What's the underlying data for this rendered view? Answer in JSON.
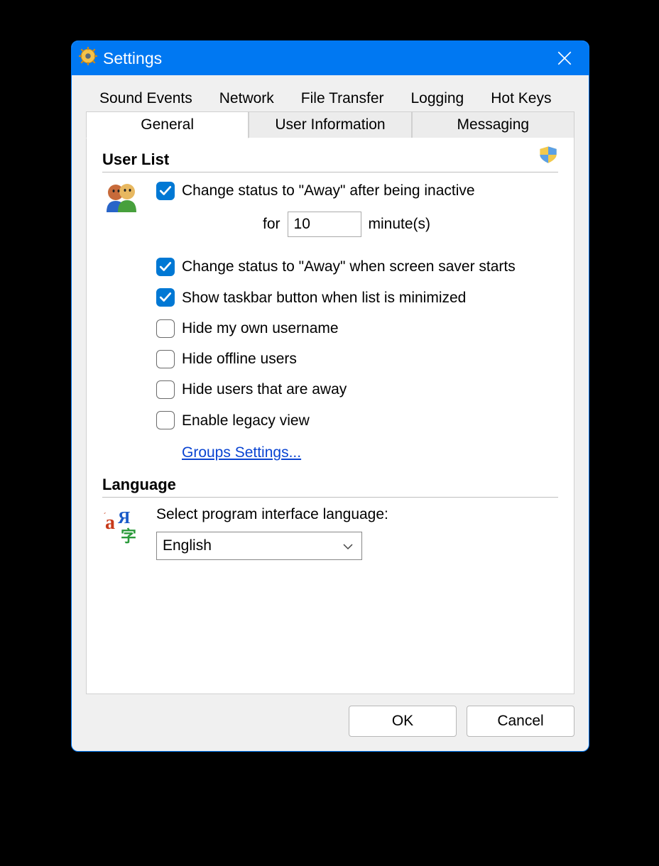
{
  "window": {
    "title": "Settings"
  },
  "tabs": {
    "row1": [
      "Sound Events",
      "Network",
      "File Transfer",
      "Logging",
      "Hot Keys"
    ],
    "row2": [
      "General",
      "User Information",
      "Messaging"
    ],
    "active": "General"
  },
  "user_list": {
    "heading": "User List",
    "options": {
      "away_inactive": {
        "checked": true,
        "label": "Change status to \"Away\" after being inactive"
      },
      "for_label": "for",
      "minutes_value": "10",
      "minutes_unit": "minute(s)",
      "away_screensaver": {
        "checked": true,
        "label": "Change status to \"Away\" when screen saver starts"
      },
      "show_taskbar": {
        "checked": true,
        "label": "Show taskbar button when list is minimized"
      },
      "hide_own": {
        "checked": false,
        "label": "Hide my own username"
      },
      "hide_offline": {
        "checked": false,
        "label": "Hide offline users"
      },
      "hide_away": {
        "checked": false,
        "label": "Hide users that are away"
      },
      "legacy_view": {
        "checked": false,
        "label": "Enable legacy view"
      }
    },
    "groups_link": "Groups Settings..."
  },
  "language": {
    "heading": "Language",
    "label": "Select program interface language:",
    "selected": "English"
  },
  "buttons": {
    "ok": "OK",
    "cancel": "Cancel"
  }
}
